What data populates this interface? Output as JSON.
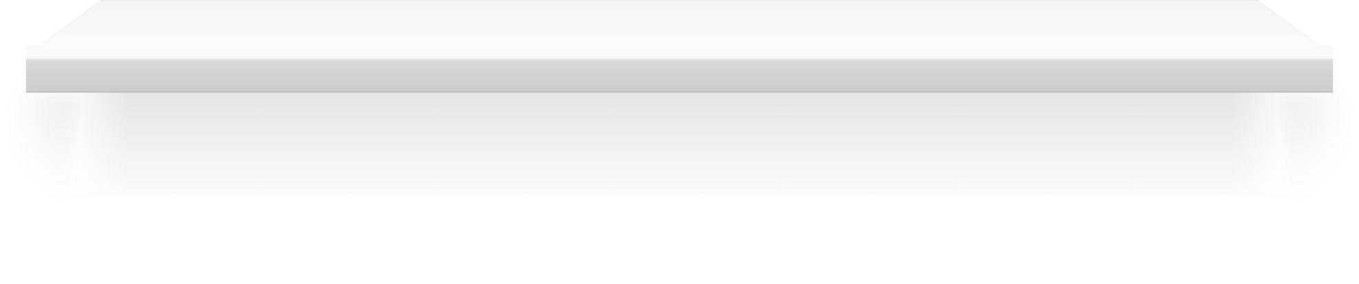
{
  "scene": {
    "kind": "empty-shelf-illustration",
    "colors": {
      "background": "#ffffff",
      "shelf_top": "#f6f6f6",
      "shelf_top_edge": "#ececec",
      "shelf_front_light": "#d7d7d6",
      "shelf_front_dark": "#cbcbca",
      "shelf_front_highlight": "#e9e9e8",
      "shelf_front_lowline": "#bdbdbc",
      "back_panel_top": "#e6e8e7",
      "back_panel_bottom": "#fbfbfb",
      "floor_shadow": "#dfe3e2"
    }
  }
}
